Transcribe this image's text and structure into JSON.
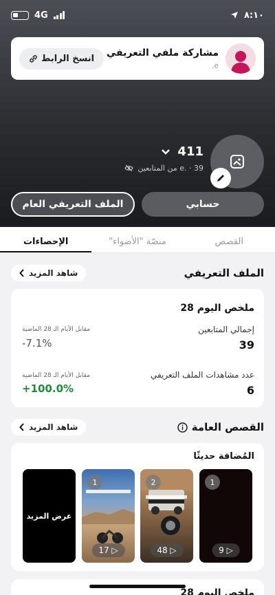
{
  "status_bar": {
    "time": "٨:١٠",
    "network": "4G"
  },
  "share": {
    "title": "مشاركة ملفي التعريفي",
    "subtitle": "e.",
    "copy_label": "انسخ الرابط"
  },
  "profile": {
    "count": "411",
    "followers_text": "e. · 39 من المتابعين"
  },
  "buttons": {
    "account": "حسابي",
    "public_profile": "الملف التعريفي العام"
  },
  "tabs": [
    {
      "label": "القصص"
    },
    {
      "label": "منصّة \"الأضواء\""
    },
    {
      "label": "الإحصاءات"
    }
  ],
  "profile_section": {
    "title": "الملف التعريفي",
    "see_more": "شاهد المزيد",
    "summary_title": "28 ملخص اليوم",
    "followers_label": "إجمالي المتابعين",
    "followers_value": "39",
    "followers_cmp_label": "مقابل الأيام الـ 28 الماضية",
    "followers_cmp_value": "-7.1%",
    "views_label": "عدد مشاهدات الملف التعريفي",
    "views_value": "6",
    "views_cmp_label": "مقابل الأيام الـ 28 الماضية",
    "views_cmp_value": "+100.0%"
  },
  "stories_section": {
    "title": "القصص العامة",
    "see_more": "شاهد المزيد",
    "recent_label": "المُضافة حديثًا",
    "more_label": "عرض المزيد",
    "thumbs": [
      {
        "num": "1",
        "views": "9"
      },
      {
        "num": "2",
        "views": "48"
      },
      {
        "num": "1",
        "views": "17"
      }
    ]
  },
  "bottom_peek": "28 ملخص اليوم",
  "colors": {
    "positive": "#1f8a3a",
    "avatar_bg": "#f3dde3",
    "avatar_fg": "#c2185b"
  }
}
